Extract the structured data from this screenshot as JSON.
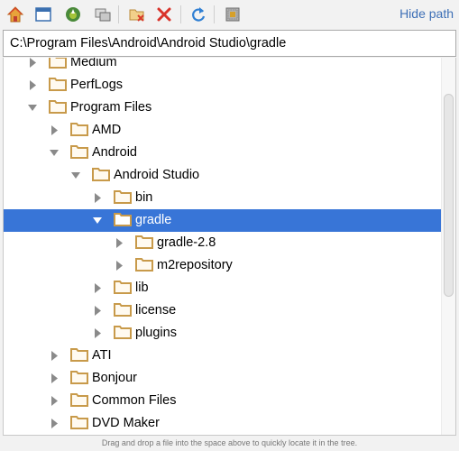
{
  "toolbar": {
    "buttons": [
      {
        "name": "home-button",
        "icon": "home-icon"
      },
      {
        "name": "desktop-button",
        "icon": "desktop-window-icon"
      },
      {
        "name": "android-project-button",
        "icon": "android-icon"
      },
      {
        "name": "module-button",
        "icon": "module-folders-icon"
      },
      {
        "name": "new-folder-button",
        "icon": "new-folder-icon"
      },
      {
        "name": "delete-button",
        "icon": "delete-x-icon"
      },
      {
        "name": "refresh-button",
        "icon": "refresh-icon"
      },
      {
        "name": "show-hidden-button",
        "icon": "show-hidden-files-icon"
      }
    ],
    "hide_path_label": "Hide path"
  },
  "path": {
    "value": "C:\\Program Files\\Android\\Android Studio\\gradle"
  },
  "tree": {
    "items": [
      {
        "label": "Medium",
        "depth": 0,
        "state": "collapsed"
      },
      {
        "label": "PerfLogs",
        "depth": 0,
        "state": "collapsed"
      },
      {
        "label": "Program Files",
        "depth": 0,
        "state": "expanded"
      },
      {
        "label": "AMD",
        "depth": 1,
        "state": "collapsed"
      },
      {
        "label": "Android",
        "depth": 1,
        "state": "expanded"
      },
      {
        "label": "Android Studio",
        "depth": 2,
        "state": "expanded"
      },
      {
        "label": "bin",
        "depth": 3,
        "state": "collapsed"
      },
      {
        "label": "gradle",
        "depth": 3,
        "state": "expanded",
        "selected": true
      },
      {
        "label": "gradle-2.8",
        "depth": 4,
        "state": "collapsed"
      },
      {
        "label": "m2repository",
        "depth": 4,
        "state": "collapsed"
      },
      {
        "label": "lib",
        "depth": 3,
        "state": "collapsed"
      },
      {
        "label": "license",
        "depth": 3,
        "state": "collapsed"
      },
      {
        "label": "plugins",
        "depth": 3,
        "state": "collapsed"
      },
      {
        "label": "ATI",
        "depth": 1,
        "state": "collapsed"
      },
      {
        "label": "Bonjour",
        "depth": 1,
        "state": "collapsed"
      },
      {
        "label": "Common Files",
        "depth": 1,
        "state": "collapsed"
      },
      {
        "label": "DVD Maker",
        "depth": 1,
        "state": "collapsed"
      }
    ]
  },
  "status": {
    "text": "Drag and drop a file into the space above to quickly locate it in the tree."
  },
  "colors": {
    "selection": "#3875d7",
    "folder": "#c89a4a",
    "link": "#3d6fb6"
  }
}
